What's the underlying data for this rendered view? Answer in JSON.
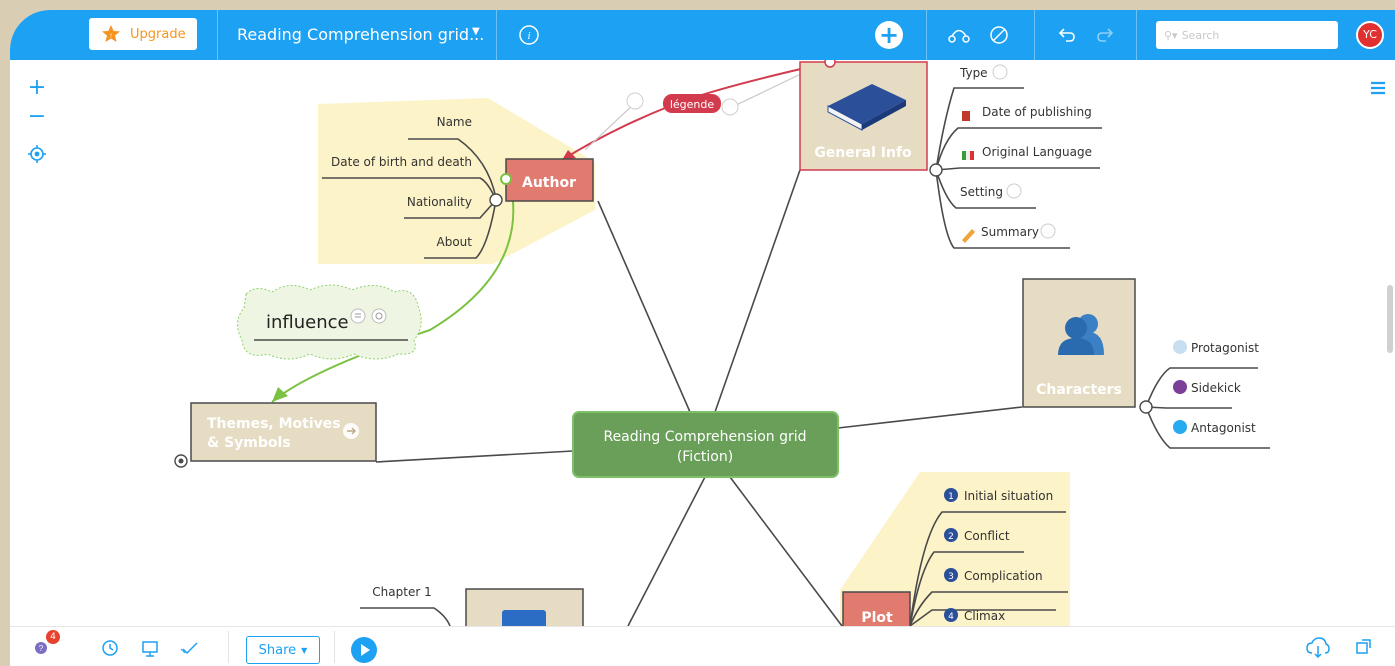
{
  "toolbar": {
    "upgrade_label": "Upgrade",
    "doc_title": "Reading Comprehension grid...",
    "search_placeholder": "Search",
    "user_initials": "YC",
    "brand_color": "#1da1f2"
  },
  "bottombar": {
    "help_badge_count": "4",
    "share_label": "Share"
  },
  "mindmap": {
    "central": {
      "line1": "Reading Comprehension grid",
      "line2": "(Fiction)"
    },
    "author": {
      "title": "Author",
      "children": [
        "Name",
        "Date of birth and death",
        "Nationality",
        "About"
      ]
    },
    "general_info": {
      "title": "General Info",
      "children": [
        "Type",
        "Date of publishing",
        "Original Language",
        "Setting",
        "Summary"
      ]
    },
    "characters": {
      "title": "Characters",
      "children": [
        "Protagonist",
        "Sidekick",
        "Antagonist"
      ]
    },
    "themes": {
      "line1": "Themes, Motives",
      "line2": "& Symbols"
    },
    "plot": {
      "title": "Plot",
      "children": [
        "Initial situation",
        "Conflict",
        "Complication",
        "Climax"
      ],
      "numbers": [
        "1",
        "2",
        "3",
        "4"
      ]
    },
    "chapters": {
      "first": "Chapter 1"
    },
    "relation_label": "légende",
    "floating_topic": "influence"
  }
}
